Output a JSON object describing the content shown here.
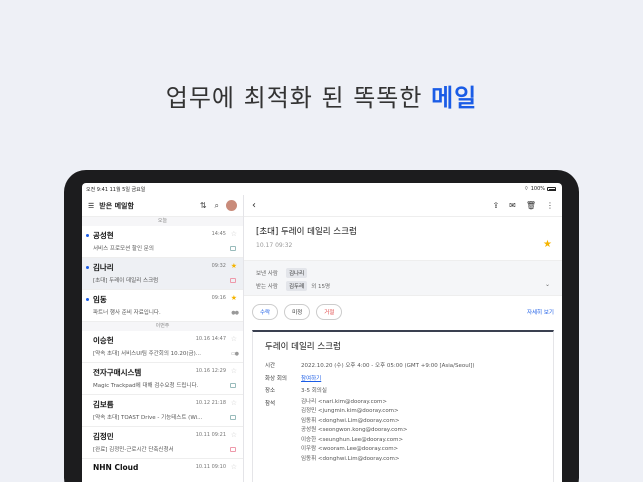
{
  "headline": {
    "text": "업무에 최적화 된 똑똑한",
    "accent": "메일"
  },
  "status_bar": {
    "time_date": "오전 9:41  11월 5일 금요일",
    "battery": "100%"
  },
  "mail_list": {
    "title": "받은 메일함",
    "group_today": "오늘",
    "group_last_week": "이번주",
    "items": [
      {
        "sender": "공성현",
        "snippet": "서비스 프로모션 할인 문의",
        "time": "14:45",
        "unread": true,
        "starred": false
      },
      {
        "sender": "김나리",
        "snippet": "[초대] 두레이 데일리 스크럼",
        "time": "09:32",
        "unread": true,
        "starred": true,
        "selected": true
      },
      {
        "sender": "임동",
        "snippet": "파트너 행사 준비 자료입니다.",
        "time": "09:16",
        "unread": true,
        "starred": true
      },
      {
        "sender": "이승헌",
        "snippet": "[약속 초대] 서비스UI팀 주간회의 10.20(금)...",
        "time": "10.16 14:47",
        "unread": false,
        "starred": false
      },
      {
        "sender": "전자구매시스템",
        "snippet": "Magic Trackpad에 대해 검수요청 드립니다.",
        "time": "10.16 12:29",
        "unread": false,
        "starred": false
      },
      {
        "sender": "김보름",
        "snippet": "[약속 초대] TOAST Drive - 기능테스트 (Wi...",
        "time": "10.12 21:18",
        "unread": false,
        "starred": false
      },
      {
        "sender": "김정민",
        "snippet": "[완료] 김정민-근로시간 단축신청서",
        "time": "10.11 09:21",
        "unread": false,
        "starred": false
      },
      {
        "sender": "NHN Cloud",
        "snippet": "",
        "time": "10.11 09:10",
        "unread": false,
        "starred": false
      }
    ]
  },
  "detail": {
    "subject": "[초대] 두레이 데일리 스크럼",
    "date": "10.17  09:32",
    "from_label": "보낸 사람",
    "from": "김나리",
    "to_label": "받는 사람",
    "to": "김두레",
    "to_more": "외 15명",
    "accept": "수락",
    "tentative": "미정",
    "decline": "거절",
    "view_detail": "자세히 보기",
    "event": {
      "title": "두레이 데일리 스크럼",
      "time_label": "시간",
      "time": "2022.10.20 (수) 오후 4:00 - 오후 05:00 (GMT +9:00 [Asia/Seoul])",
      "video_label": "화상 회의",
      "video_link": "참여하기",
      "place_label": "장소",
      "place": "3-5 회의실",
      "attendees_label": "참석",
      "attendees": [
        "김나리 <nari.kim@dooray.com>",
        "김정민 <jungmin.kim@dooray.com>",
        "임동휘 <donghwi.Lim@dooray.com>",
        "공성원 <seongwon.kong@dooray.com>",
        "이승한 <seunghun.Lee@dooray.com>",
        "이우람 <wooram.Lee@dooray.com>",
        "임동휘 <donghwi.Lim@dooray.com>"
      ]
    }
  },
  "colors": {
    "accent": "#1a5ce6",
    "star": "#f5b400",
    "decline": "#e04545"
  }
}
